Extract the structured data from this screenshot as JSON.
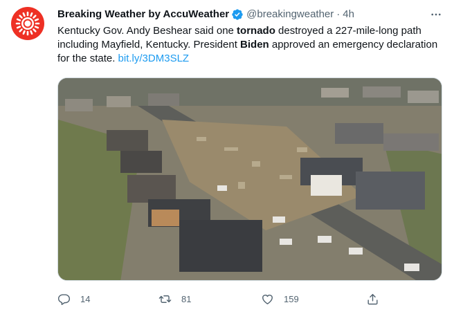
{
  "tweet": {
    "author_name": "Breaking Weather by AccuWeather",
    "handle": "@breakingweather",
    "separator": "·",
    "time": "4h",
    "text": {
      "p1": "Kentucky Gov. Andy Beshear said one ",
      "b1": "tornado",
      "p2": " destroyed a 227-mile-long path including Mayfield, Kentucky. President ",
      "b2": "Biden",
      "p3": " approved an emergency declaration for the state. ",
      "link": "bit.ly/3DM3SLZ"
    },
    "image_desc": "aerial view of tornado-destroyed neighborhood",
    "actions": {
      "replies": "14",
      "retweets": "81",
      "likes": "159"
    }
  },
  "colors": {
    "brand_red": "#ee3024",
    "verified_blue": "#1d9bf0",
    "link_blue": "#1d9bf0",
    "muted_gray": "#536471"
  },
  "icons": [
    "accuweather-logo-icon",
    "verified-badge-icon",
    "more-icon",
    "reply-icon",
    "retweet-icon",
    "like-icon",
    "share-icon"
  ]
}
